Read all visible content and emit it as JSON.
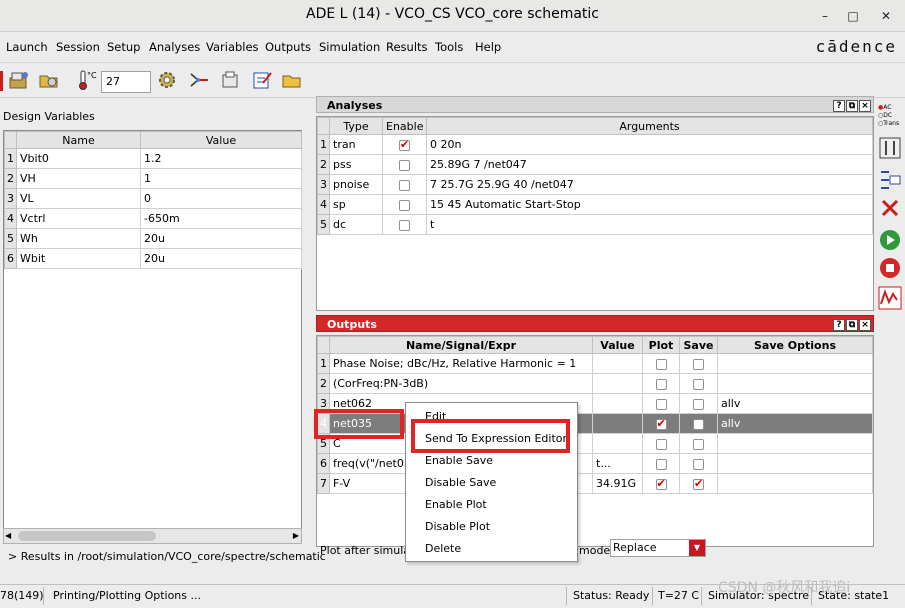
{
  "window": {
    "title": "ADE L (14) - VCO_CS VCO_core schematic",
    "minimize": "–",
    "maximize": "□",
    "close": "✕"
  },
  "menu": [
    "Launch",
    "Session",
    "Setup",
    "Analyses",
    "Variables",
    "Outputs",
    "Simulation",
    "Results",
    "Tools",
    "Help"
  ],
  "brand": "cādence",
  "toolbar": {
    "temperature": "27",
    "temp_icon_label": "°C"
  },
  "design_variables": {
    "label": "Design Variables",
    "columns": [
      "Name",
      "Value"
    ],
    "rows": [
      {
        "num": "1",
        "name": "Vbit0",
        "value": "1.2"
      },
      {
        "num": "2",
        "name": "VH",
        "value": "1"
      },
      {
        "num": "3",
        "name": "VL",
        "value": "0"
      },
      {
        "num": "4",
        "name": "Vctrl",
        "value": "-650m"
      },
      {
        "num": "5",
        "name": "Wh",
        "value": "20u"
      },
      {
        "num": "6",
        "name": "Wbit",
        "value": "20u"
      }
    ]
  },
  "results_path": "> Results in /root/simulation/VCO_core/spectre/schematic",
  "analyses": {
    "title": "Analyses",
    "columns": [
      "Type",
      "Enable",
      "Arguments"
    ],
    "rows": [
      {
        "num": "1",
        "type": "tran",
        "enabled": true,
        "args": "0 20n"
      },
      {
        "num": "2",
        "type": "pss",
        "enabled": false,
        "args": "25.89G 7 /net047"
      },
      {
        "num": "3",
        "type": "pnoise",
        "enabled": false,
        "args": "7 25.7G 25.9G 40 /net047"
      },
      {
        "num": "4",
        "type": "sp",
        "enabled": false,
        "args": "15 45 Automatic Start-Stop"
      },
      {
        "num": "5",
        "type": "dc",
        "enabled": false,
        "args": "t"
      }
    ]
  },
  "outputs": {
    "title": "Outputs",
    "columns": [
      "Name/Signal/Expr",
      "Value",
      "Plot",
      "Save",
      "Save Options"
    ],
    "rows": [
      {
        "num": "1",
        "name": "Phase Noise; dBc/Hz, Relative Harmonic = 1",
        "value": "",
        "plot": false,
        "save": false,
        "opts": ""
      },
      {
        "num": "2",
        "name": "(CorFreq:PN-3dB)",
        "value": "",
        "plot": false,
        "save": false,
        "opts": ""
      },
      {
        "num": "3",
        "name": "net062",
        "value": "",
        "plot": false,
        "save": false,
        "opts": "allv"
      },
      {
        "num": "4",
        "name": "net035",
        "value": "",
        "plot": true,
        "save": false,
        "opts": "allv"
      },
      {
        "num": "5",
        "name": "C",
        "value": "",
        "plot": false,
        "save": false,
        "opts": ""
      },
      {
        "num": "6",
        "name": "freq(v(\"/net035",
        "value": "t...",
        "plot": false,
        "save": false,
        "opts": ""
      },
      {
        "num": "7",
        "name": "F-V",
        "value": "34.91G",
        "plot": true,
        "save": true,
        "opts": ""
      }
    ],
    "plot_after": "Plot after simulat",
    "mode_label": "mode:",
    "mode_value": "Replace"
  },
  "context_menu": [
    "Edit",
    "Send To Expression Editor",
    "Enable Save",
    "Disable Save",
    "Enable Plot",
    "Disable Plot",
    "Delete"
  ],
  "sidebar": {
    "ac": "AC",
    "dc": "DC",
    "trans": "Trans"
  },
  "statusbar": {
    "left": "78(149)",
    "message": "Printing/Plotting Options ...",
    "status": "Status: Ready",
    "temp": "T=27 C",
    "simulator": "Simulator: spectre",
    "state": "State: state1"
  },
  "watermark": "CSDN @秋风和我追i"
}
